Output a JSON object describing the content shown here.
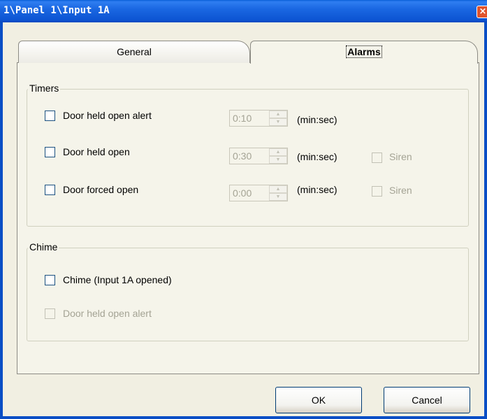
{
  "window": {
    "title": "1\\Panel 1\\Input 1A",
    "close_glyph": "×"
  },
  "tabs": [
    {
      "label": "General",
      "active": false
    },
    {
      "label": "Alarms",
      "active": true
    }
  ],
  "timers": {
    "label": "Timers",
    "rows": [
      {
        "label": "Door held open alert",
        "checked": false,
        "value": "0:10",
        "unit": "(min:sec)"
      },
      {
        "label": "Door held open",
        "checked": false,
        "value": "0:30",
        "unit": "(min:sec)",
        "siren_label": "Siren"
      },
      {
        "label": "Door forced open",
        "checked": false,
        "value": "0:00",
        "unit": "(min:sec)",
        "siren_label": "Siren"
      }
    ]
  },
  "chime": {
    "label": "Chime",
    "items": [
      {
        "label": "Chime (Input 1A opened)",
        "checked": false,
        "enabled": true
      },
      {
        "label": "Door held open alert",
        "checked": false,
        "enabled": false
      }
    ]
  },
  "buttons": {
    "ok": "OK",
    "cancel": "Cancel"
  },
  "icons": {
    "spin_up": "▲",
    "spin_down": "▼",
    "close": "close-icon"
  },
  "colors": {
    "titlebar": "#0d55d3",
    "dialog_bg": "#f5f4ea",
    "close_button": "#e0532c"
  }
}
